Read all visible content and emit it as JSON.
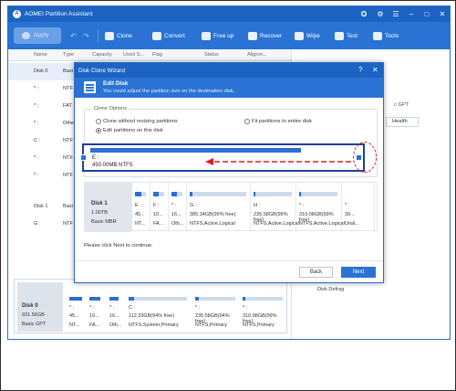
{
  "app": {
    "title": "AOMEI Partition Assistant"
  },
  "toolbar": {
    "apply": "Apply",
    "items": [
      "Clone",
      "Convert",
      "Free up",
      "Recover",
      "Wipe",
      "Test",
      "Tools"
    ]
  },
  "columns": [
    "Name",
    "Type",
    "Capacity",
    "Used S...",
    "Flag",
    "Status",
    "Alignm..."
  ],
  "rows": [
    {
      "name": "Disk 0",
      "type": "Basi"
    },
    {
      "name": "* :",
      "type": "NTF"
    },
    {
      "name": "* :",
      "type": "FAT"
    },
    {
      "name": "* :",
      "type": "Othe"
    },
    {
      "name": "C :",
      "type": "NTF"
    },
    {
      "name": "* :",
      "type": "NTF"
    },
    {
      "name": "* :",
      "type": "NTF"
    },
    {
      "name": "Disk 1",
      "type": "Basi"
    },
    {
      "name": "G :",
      "type": "NTF"
    }
  ],
  "right_pane": {
    "gpt_label": "c GPT",
    "health_button": "Health",
    "defrag": "Disk Defrag"
  },
  "bottom_disk": {
    "name": "Disk 0",
    "size": "931.56GB",
    "type": "Basic GPT",
    "parts": [
      {
        "l1": "* :",
        "l2": "45..."
      },
      {
        "l1": "* :",
        "l2": "10..."
      },
      {
        "l1": "* :",
        "l2": "16..."
      },
      {
        "l1": "C :",
        "l2": "112.33GB(94% free)",
        "l3": "NTFS,System,Primary"
      },
      {
        "l1": "* :",
        "l2": "235.58GB(94% free)",
        "l3": "NTFS,Primary"
      },
      {
        "l1": "* :",
        "l2": "310.08GB(99% free)",
        "l3": "NTFS,Primary"
      }
    ],
    "sub": [
      "NT...",
      "FA...",
      "Oth..."
    ]
  },
  "dialog": {
    "title": "Disk Clone Wizard",
    "heading": "Edit Disk",
    "subheading": "You could adjust the partition size on the destination disk.",
    "options_legend": "Clone Options",
    "opt1": "Clone without resizing partitions",
    "opt2": "Fit partitions to entire disk",
    "opt3": "Edit partitions on this disk",
    "bar_letter": "E :",
    "bar_size": "450.00MB NTFS",
    "bar_fill_fraction": 0.78,
    "disk": {
      "name": "Disk 1",
      "size": "1.00TB",
      "type": "Basic MBR"
    },
    "parts": [
      {
        "l1": "E :",
        "l2": "45...",
        "l3": "NT...",
        "fill": 0.6
      },
      {
        "l1": "F :",
        "l2": "10...",
        "l3": "FA...",
        "fill": 0.5
      },
      {
        "l1": "* :",
        "l2": "16...",
        "l3": "Oth...",
        "fill": 0.5
      },
      {
        "l1": "G :",
        "l2": "385.34GB(99% free)",
        "l3": "NTFS,Active,Logical",
        "fill": 0.05
      },
      {
        "l1": "H :",
        "l2": "235.58GB(99% free)",
        "l3": "NTFS,Active,Logical",
        "fill": 0.05
      },
      {
        "l1": "* :",
        "l2": "310.08GB(99% free)",
        "l3": "NTFS,Active,Logical",
        "fill": 0.05
      },
      {
        "l1": "* :",
        "l2": "39...",
        "l3": "Unal...",
        "fill": 0
      }
    ],
    "note": "Please click Next to continue.",
    "back": "Back",
    "next": "Next"
  }
}
